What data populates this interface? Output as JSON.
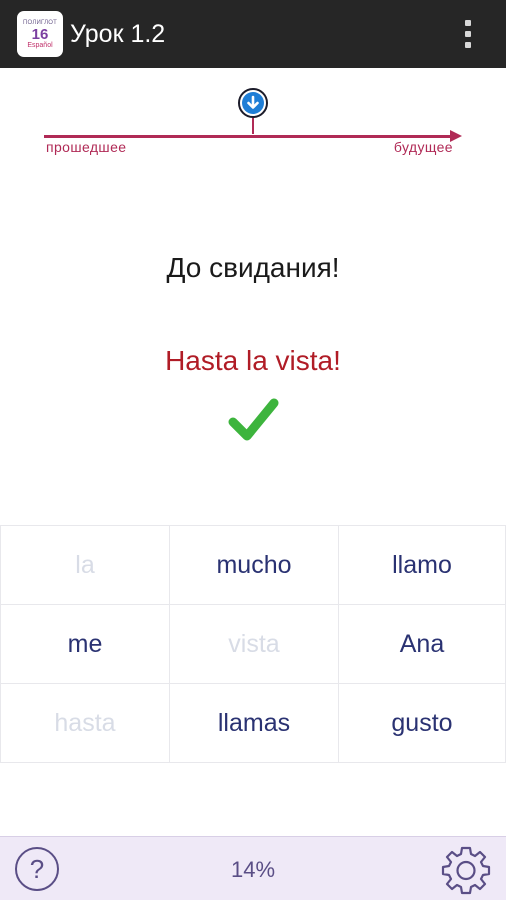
{
  "app_bar": {
    "icon_text_top": "ПОЛИГЛОТ",
    "icon_text_number": "16",
    "icon_text_bottom": "Español",
    "title": "Урок 1.2",
    "overflow_icon": "overflow-menu-icon"
  },
  "timeline": {
    "marker_icon": "arrow-down-circle-icon",
    "past_label": "прошедшее",
    "future_label": "будущее",
    "accent_color": "#b02a56"
  },
  "phrase": {
    "russian": "До свидания!",
    "spanish": "Hasta la vista!",
    "result_icon": "check-icon",
    "spanish_color": "#b01c26",
    "check_color": "#3db43d"
  },
  "word_grid": {
    "words": [
      {
        "text": "la",
        "used": true
      },
      {
        "text": "mucho",
        "used": false
      },
      {
        "text": "llamo",
        "used": false
      },
      {
        "text": "me",
        "used": false
      },
      {
        "text": "vista",
        "used": true
      },
      {
        "text": "Ana",
        "used": false
      },
      {
        "text": "hasta",
        "used": true
      },
      {
        "text": "llamas",
        "used": false
      },
      {
        "text": "gusto",
        "used": false
      }
    ],
    "active_color": "#2a3272",
    "used_color": "#d8dce6"
  },
  "bottom_bar": {
    "help_label": "?",
    "progress": "14%",
    "settings_icon": "gear-icon",
    "background": "#efe9f7"
  }
}
